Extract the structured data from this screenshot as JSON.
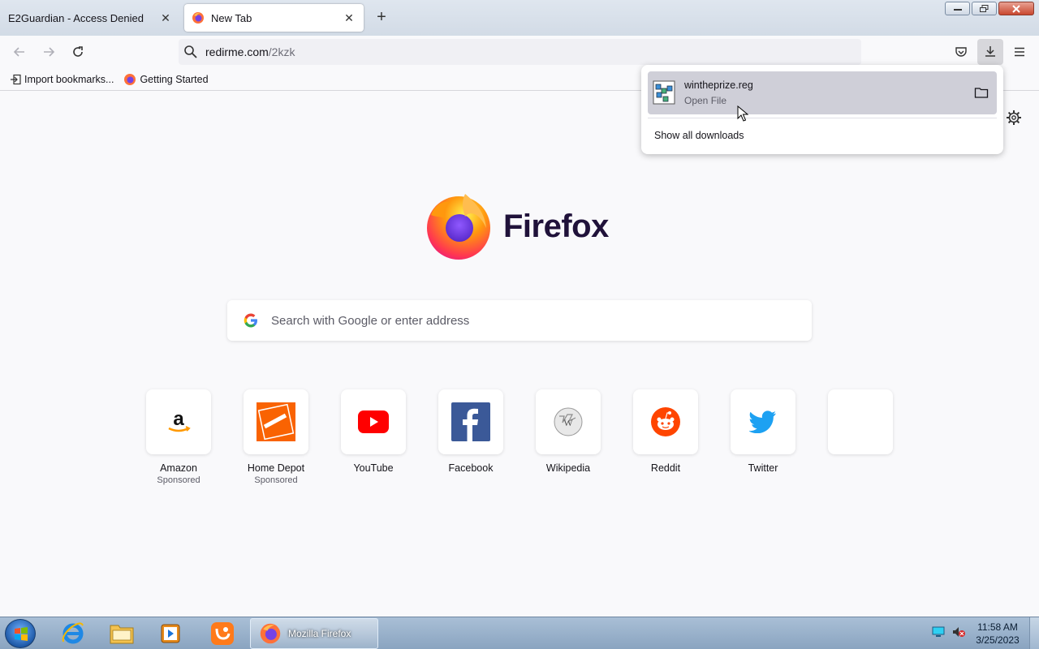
{
  "browser": {
    "tabs": [
      {
        "title": "E2Guardian - Access Denied",
        "active": false
      },
      {
        "title": "New Tab",
        "active": true
      }
    ],
    "url": {
      "host": "redirme.com",
      "path": "/2kzk"
    },
    "bookmarks": [
      {
        "label": "Import bookmarks...",
        "icon": "import-icon"
      },
      {
        "label": "Getting Started",
        "icon": "firefox-icon"
      }
    ]
  },
  "newtab": {
    "wordmark": "Firefox",
    "search_placeholder": "Search with Google or enter address",
    "tiles": [
      {
        "label": "Amazon",
        "sponsored": "Sponsored",
        "icon": "amazon-icon"
      },
      {
        "label": "Home Depot",
        "sponsored": "Sponsored",
        "icon": "home-depot-icon"
      },
      {
        "label": "YouTube",
        "sponsored": "",
        "icon": "youtube-icon"
      },
      {
        "label": "Facebook",
        "sponsored": "",
        "icon": "facebook-icon"
      },
      {
        "label": "Wikipedia",
        "sponsored": "",
        "icon": "wikipedia-icon"
      },
      {
        "label": "Reddit",
        "sponsored": "",
        "icon": "reddit-icon"
      },
      {
        "label": "Twitter",
        "sponsored": "",
        "icon": "twitter-icon"
      },
      {
        "label": "",
        "sponsored": "",
        "icon": "empty-tile"
      }
    ]
  },
  "downloads": {
    "items": [
      {
        "filename": "wintheprize.reg",
        "status": "Open File"
      }
    ],
    "show_all": "Show all downloads"
  },
  "taskbar": {
    "active_window": "Mozilla Firefox",
    "time": "11:58 AM",
    "date": "3/25/2023"
  },
  "colors": {
    "accent_blue": "#0061e0",
    "youtube_red": "#ff0000",
    "facebook_blue": "#3b5998",
    "reddit_orange": "#ff4500",
    "twitter_blue": "#1da1f2",
    "homedepot_orange": "#f96302"
  }
}
